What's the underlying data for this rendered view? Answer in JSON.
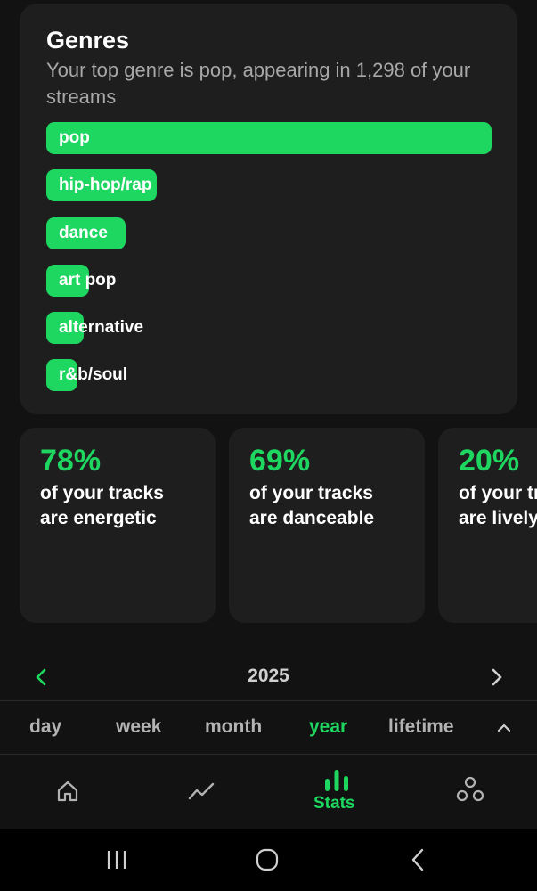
{
  "genres": {
    "title": "Genres",
    "subtitle": "Your top genre is pop, appearing in 1,298 of your streams",
    "items": [
      {
        "label": "pop",
        "share": 1.0
      },
      {
        "label": "hip-hop/rap",
        "share": 0.248
      },
      {
        "label": "dance",
        "share": 0.178
      },
      {
        "label": "art pop",
        "share": 0.096
      },
      {
        "label": "alternative",
        "share": 0.084
      },
      {
        "label": "r&b/soul",
        "share": 0.07
      }
    ]
  },
  "stats": [
    {
      "percent": "78%",
      "line1": "of your tracks",
      "line2": "are energetic"
    },
    {
      "percent": "69%",
      "line1": "of your tracks",
      "line2": "are danceable"
    },
    {
      "percent": "20%",
      "line1": "of your tracks",
      "line2": "are lively"
    }
  ],
  "year_selector": {
    "year": "2025"
  },
  "range_tabs": {
    "tabs": [
      "day",
      "week",
      "month",
      "year",
      "lifetime"
    ],
    "active": "year"
  },
  "nav": {
    "stats_label": "Stats",
    "active": "stats"
  },
  "colors": {
    "accent": "#1ed760",
    "background": "#121212",
    "card": "#1e1e1e",
    "muted_text": "#a8a8a8"
  },
  "icons": {
    "year_prev": "chevron-left-icon",
    "year_next": "chevron-right-icon",
    "range_collapse": "chevron-up-icon",
    "nav_home": "home-icon",
    "nav_trends": "trend-line-icon",
    "nav_stats": "bar-chart-icon",
    "nav_social": "people-dots-icon",
    "sys_recents": "recent-apps-icon",
    "sys_home": "home-circle-icon",
    "sys_back": "back-chevron-icon"
  }
}
